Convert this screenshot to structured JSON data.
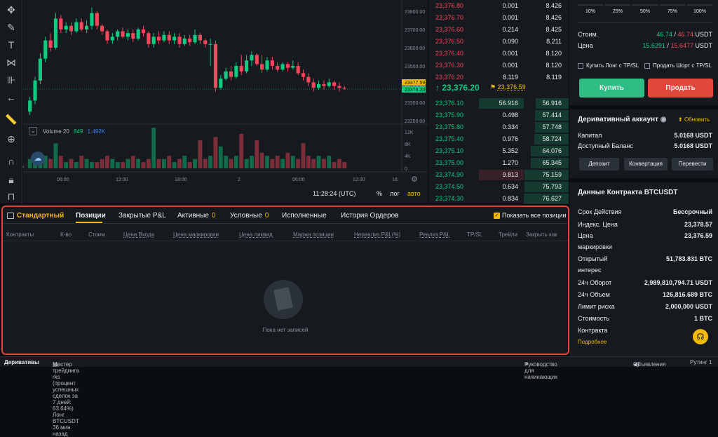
{
  "chart": {
    "price_ticks": [
      "23800.00",
      "23700.00",
      "23600.00",
      "23500.00",
      "23400.00",
      "23300.00",
      "23200.00"
    ],
    "price_tag_high": "23377.59",
    "price_tag_low": "23376.20",
    "volume_ticks": [
      "12K",
      "8K",
      "4K",
      "0"
    ],
    "time_ticks": [
      "06:00",
      "12:00",
      "18:00",
      "2",
      "06:00",
      "12:00",
      "16:"
    ],
    "volume_label": "Volume 20",
    "volume_val1": "849",
    "volume_val2": "1.492K",
    "clock": "11:28:24 (UTC)",
    "percent_btn": "%",
    "log_btn": "лог",
    "auto_btn": "авто"
  },
  "chart_data": {
    "type": "candlestick",
    "up_color": "#0ecb81",
    "down_color": "#f6465d",
    "ylim": [
      23200,
      23820
    ],
    "candles": [
      [
        23250,
        23310,
        23230,
        23330
      ],
      [
        23310,
        23420,
        23290,
        23440
      ],
      [
        23420,
        23540,
        23400,
        23570
      ],
      [
        23540,
        23640,
        23520,
        23660
      ],
      [
        23640,
        23600,
        23580,
        23680
      ],
      [
        23600,
        23760,
        23590,
        23790
      ],
      [
        23760,
        23700,
        23680,
        23780
      ],
      [
        23700,
        23720,
        23680,
        23740
      ],
      [
        23720,
        23690,
        23670,
        23740
      ],
      [
        23690,
        23740,
        23680,
        23760
      ],
      [
        23740,
        23700,
        23690,
        23760
      ],
      [
        23700,
        23720,
        23680,
        23750
      ],
      [
        23720,
        23790,
        23700,
        23820
      ],
      [
        23790,
        23720,
        23700,
        23800
      ],
      [
        23720,
        23690,
        23670,
        23730
      ],
      [
        23690,
        23640,
        23620,
        23700
      ],
      [
        23640,
        23660,
        23620,
        23680
      ],
      [
        23660,
        23690,
        23640,
        23700
      ],
      [
        23690,
        23660,
        23650,
        23710
      ],
      [
        23660,
        23680,
        23640,
        23700
      ],
      [
        23680,
        23650,
        23630,
        23700
      ],
      [
        23650,
        23700,
        23640,
        23710
      ],
      [
        23700,
        23680,
        23660,
        23720
      ],
      [
        23680,
        23620,
        23600,
        23690
      ],
      [
        23620,
        23660,
        23600,
        23680
      ],
      [
        23660,
        23640,
        23620,
        23690
      ],
      [
        23640,
        23670,
        23630,
        23690
      ],
      [
        23670,
        23640,
        23620,
        23690
      ],
      [
        23640,
        23660,
        23620,
        23680
      ],
      [
        23660,
        23620,
        23600,
        23680
      ],
      [
        23620,
        23650,
        23610,
        23670
      ],
      [
        23650,
        23630,
        23610,
        23670
      ],
      [
        23630,
        23670,
        23620,
        23700
      ],
      [
        23670,
        23640,
        23620,
        23680
      ],
      [
        23640,
        23620,
        23600,
        23650
      ],
      [
        23620,
        23620,
        23500,
        23650
      ],
      [
        23620,
        23380,
        23360,
        23640
      ],
      [
        23380,
        23430,
        23370,
        23450
      ],
      [
        23430,
        23470,
        23420,
        23490
      ],
      [
        23470,
        23440,
        23420,
        23500
      ],
      [
        23440,
        23500,
        23430,
        23520
      ],
      [
        23500,
        23470,
        23450,
        23560
      ],
      [
        23470,
        23530,
        23460,
        23560
      ],
      [
        23530,
        23560,
        23500,
        23580
      ],
      [
        23560,
        23510,
        23500,
        23570
      ],
      [
        23510,
        23480,
        23460,
        23560
      ],
      [
        23480,
        23530,
        23470,
        23550
      ],
      [
        23530,
        23500,
        23480,
        23550
      ],
      [
        23500,
        23480,
        23470,
        23520
      ],
      [
        23480,
        23510,
        23470,
        23520
      ],
      [
        23510,
        23490,
        23470,
        23520
      ],
      [
        23490,
        23500,
        23480,
        23530
      ],
      [
        23500,
        23460,
        23450,
        23520
      ],
      [
        23460,
        23440,
        23420,
        23480
      ],
      [
        23440,
        23410,
        23390,
        23460
      ],
      [
        23410,
        23380,
        23360,
        23430
      ],
      [
        23380,
        23400,
        23370,
        23420
      ],
      [
        23400,
        23390,
        23370,
        23420
      ],
      [
        23390,
        23410,
        23380,
        23430
      ],
      [
        23410,
        23390,
        23370,
        23420
      ],
      [
        23390,
        23380,
        23360,
        23410
      ],
      [
        23380,
        23377,
        23370,
        23390
      ]
    ],
    "volumes": [
      3,
      2,
      5,
      4,
      3,
      8,
      4,
      2,
      3,
      2,
      4,
      3,
      2,
      2,
      3,
      4,
      3,
      2,
      2,
      3,
      4,
      3,
      2,
      3,
      13,
      3,
      3,
      4,
      2,
      3,
      4,
      2,
      3,
      9,
      3,
      4,
      10,
      7,
      4,
      3,
      4,
      11,
      3,
      4,
      9,
      5,
      4,
      3,
      4,
      3,
      5,
      4,
      3,
      8,
      4,
      3,
      4,
      3,
      4,
      2,
      3,
      2
    ]
  },
  "orderbook": {
    "asks": [
      {
        "price": "23,376.80",
        "amount": "0.001",
        "total": "8.426"
      },
      {
        "price": "23,376.70",
        "amount": "0.001",
        "total": "8.426"
      },
      {
        "price": "23,376.60",
        "amount": "0.214",
        "total": "8.425"
      },
      {
        "price": "23,376.50",
        "amount": "0.090",
        "total": "8.211"
      },
      {
        "price": "23,376.40",
        "amount": "0.001",
        "total": "8.120"
      },
      {
        "price": "23,376.30",
        "amount": "0.001",
        "total": "8.120"
      },
      {
        "price": "23,376.20",
        "amount": "8.119",
        "total": "8.119"
      }
    ],
    "last_price": "23,376.20",
    "mark_price": "23,376.59",
    "bids": [
      {
        "price": "23,376.10",
        "amount": "56.916",
        "total": "56.916"
      },
      {
        "price": "23,375.90",
        "amount": "0.498",
        "total": "57.414"
      },
      {
        "price": "23,375.80",
        "amount": "0.334",
        "total": "57.748"
      },
      {
        "price": "23,375.40",
        "amount": "0.976",
        "total": "58.724"
      },
      {
        "price": "23,375.10",
        "amount": "5.352",
        "total": "64.076"
      },
      {
        "price": "23,375.00",
        "amount": "1.270",
        "total": "65.345"
      },
      {
        "price": "23,374.90",
        "amount": "9.813",
        "total": "75.159"
      },
      {
        "price": "23,374.50",
        "amount": "0.634",
        "total": "75.793"
      },
      {
        "price": "23,374.30",
        "amount": "0.834",
        "total": "76.627"
      }
    ],
    "bid_depth_fractions": [
      0.74,
      0.75,
      0.75,
      0.77,
      0.84,
      0.85,
      0.98,
      0.99,
      1.0
    ]
  },
  "trade": {
    "pct": [
      "10%",
      "25%",
      "50%",
      "75%",
      "100%"
    ],
    "cost_label": "Стоим.",
    "cost_long": "46.74",
    "cost_short": "46.74",
    "cost_unit": "USDT",
    "price_label": "Цена",
    "price_long": "15.6291",
    "price_short": "15.6477",
    "price_unit": "USDT",
    "chk_long": "Купить Лонг с TP/SL",
    "chk_short": "Продать Шорт с TP/SL",
    "buy": "Купить",
    "sell": "Продать"
  },
  "account": {
    "title": "Деривативный аккаунт",
    "refresh": "Обновить",
    "capital_label": "Капитал",
    "capital_value": "5.0168 USDT",
    "available_label": "Доступный Баланс",
    "available_value": "5.0168 USDT",
    "deposit": "Депозит",
    "convert": "Конвертация",
    "transfer": "Перевести"
  },
  "contract": {
    "title": "Данные Контракта BTCUSDT",
    "rows": [
      {
        "k": "Срок Действия",
        "v": "Бессрочный"
      },
      {
        "k": "Индекс. Цена",
        "v": "23,378.57"
      },
      {
        "k": "Цена",
        "v": "23,376.59"
      },
      {
        "k": "маркировки",
        "v": ""
      },
      {
        "k": "Открытый",
        "v": "51,783.831 BTC"
      },
      {
        "k": "интерес",
        "v": ""
      },
      {
        "k": "24ч Оборот",
        "v": "2,989,810,794.71 USDT"
      },
      {
        "k": "24ч Объем",
        "v": "126,816.689 BTC"
      },
      {
        "k": "Лимит риска",
        "v": "2,000,000 USDT"
      },
      {
        "k": "Стоимость",
        "v": "1 BTC"
      },
      {
        "k": "Контракта",
        "v": ""
      }
    ],
    "more": "Подробнее"
  },
  "positions": {
    "tabs": [
      {
        "label": "Стандартный",
        "count": ""
      },
      {
        "label": "Позиции",
        "count": ""
      },
      {
        "label": "Закрытые P&L",
        "count": ""
      },
      {
        "label": "Активные",
        "count": "0"
      },
      {
        "label": "Условные",
        "count": "0"
      },
      {
        "label": "Исполненные",
        "count": ""
      },
      {
        "label": "История Ордеров",
        "count": ""
      }
    ],
    "show_all": "Показать все позиции",
    "columns": [
      "Контракты",
      "К-во",
      "Стоим.",
      "Цена Входа",
      "Цена маркировки",
      "Цена ликвид.",
      "Маржа позиции",
      "Нереализ.P&L(%)",
      "Реализ.P&L",
      "TP/SL",
      "Трейли",
      "Закрыть как"
    ],
    "empty": "Пока нет записей"
  },
  "statusbar": {
    "derivatives": "Деривативы",
    "ticker": "Мастер трейдинга rks (процент успешных сделок за 7 дней: 63.64%) Лонг BTCUSDT 36 мин. назад",
    "guide": "Руководство для начинающих",
    "announcements": "Объявления",
    "routing": "Рутинг 1"
  }
}
